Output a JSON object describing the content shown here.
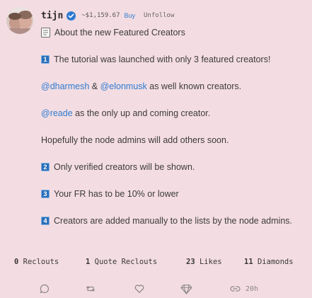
{
  "post": {
    "username": "tijn",
    "coin_price": "~$1,159.67",
    "buy_label": "Buy",
    "unfollow_label": "Unfollow",
    "lines": {
      "title": "About the new Featured Creators",
      "l1_num": "1",
      "l1": "The tutorial was launched with only 3 featured creators!",
      "mention1": "@dharmesh",
      "amp": " & ",
      "mention2": "@elonmusk",
      "l2_rest": " as well known creators.",
      "mention3": "@reade",
      "l3_rest": " as the only up and coming creator.",
      "l4": "Hopefully the node admins will add others soon.",
      "l5_num": "2",
      "l5": "Only verified creators will be shown.",
      "l6_num": "3",
      "l6": "Your FR has to be 10% or lower",
      "l7_num": "4",
      "l7": "Creators are added manually to the lists by the node admins."
    },
    "stats": {
      "reclouts_count": "0",
      "reclouts_label": " Reclouts",
      "quote_count": "1",
      "quote_label": " Quote Reclouts",
      "likes_count": "23",
      "likes_label": " Likes",
      "diamonds_count": "11",
      "diamonds_label": " Diamonds"
    },
    "actions": {
      "icons": [
        "comment-icon",
        "reclout-icon",
        "heart-icon",
        "diamond-icon",
        "link-icon"
      ],
      "time": "20h"
    },
    "colors": {
      "background": "#f3dde2",
      "link": "#2f7bd1",
      "verified": "#2f7bd1",
      "number_emoji": "#2a6fb8"
    }
  }
}
